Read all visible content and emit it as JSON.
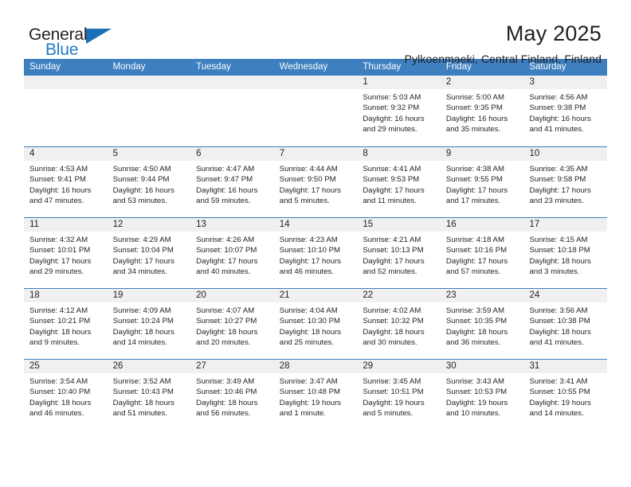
{
  "brand": {
    "name_top": "General",
    "name_bottom": "Blue",
    "accent_color": "#1b6fb5"
  },
  "header": {
    "month_title": "May 2025",
    "location": "Pylkoenmaeki, Central Finland, Finland"
  },
  "calendar": {
    "header_color": "#3d7fbf",
    "band_color": "#f0f0f0",
    "weekdays": [
      "Sunday",
      "Monday",
      "Tuesday",
      "Wednesday",
      "Thursday",
      "Friday",
      "Saturday"
    ],
    "weeks": [
      [
        {
          "day": "",
          "lines": []
        },
        {
          "day": "",
          "lines": []
        },
        {
          "day": "",
          "lines": []
        },
        {
          "day": "",
          "lines": []
        },
        {
          "day": "1",
          "lines": [
            "Sunrise: 5:03 AM",
            "Sunset: 9:32 PM",
            "Daylight: 16 hours",
            "and 29 minutes."
          ]
        },
        {
          "day": "2",
          "lines": [
            "Sunrise: 5:00 AM",
            "Sunset: 9:35 PM",
            "Daylight: 16 hours",
            "and 35 minutes."
          ]
        },
        {
          "day": "3",
          "lines": [
            "Sunrise: 4:56 AM",
            "Sunset: 9:38 PM",
            "Daylight: 16 hours",
            "and 41 minutes."
          ]
        }
      ],
      [
        {
          "day": "4",
          "lines": [
            "Sunrise: 4:53 AM",
            "Sunset: 9:41 PM",
            "Daylight: 16 hours",
            "and 47 minutes."
          ]
        },
        {
          "day": "5",
          "lines": [
            "Sunrise: 4:50 AM",
            "Sunset: 9:44 PM",
            "Daylight: 16 hours",
            "and 53 minutes."
          ]
        },
        {
          "day": "6",
          "lines": [
            "Sunrise: 4:47 AM",
            "Sunset: 9:47 PM",
            "Daylight: 16 hours",
            "and 59 minutes."
          ]
        },
        {
          "day": "7",
          "lines": [
            "Sunrise: 4:44 AM",
            "Sunset: 9:50 PM",
            "Daylight: 17 hours",
            "and 5 minutes."
          ]
        },
        {
          "day": "8",
          "lines": [
            "Sunrise: 4:41 AM",
            "Sunset: 9:53 PM",
            "Daylight: 17 hours",
            "and 11 minutes."
          ]
        },
        {
          "day": "9",
          "lines": [
            "Sunrise: 4:38 AM",
            "Sunset: 9:55 PM",
            "Daylight: 17 hours",
            "and 17 minutes."
          ]
        },
        {
          "day": "10",
          "lines": [
            "Sunrise: 4:35 AM",
            "Sunset: 9:58 PM",
            "Daylight: 17 hours",
            "and 23 minutes."
          ]
        }
      ],
      [
        {
          "day": "11",
          "lines": [
            "Sunrise: 4:32 AM",
            "Sunset: 10:01 PM",
            "Daylight: 17 hours",
            "and 29 minutes."
          ]
        },
        {
          "day": "12",
          "lines": [
            "Sunrise: 4:29 AM",
            "Sunset: 10:04 PM",
            "Daylight: 17 hours",
            "and 34 minutes."
          ]
        },
        {
          "day": "13",
          "lines": [
            "Sunrise: 4:26 AM",
            "Sunset: 10:07 PM",
            "Daylight: 17 hours",
            "and 40 minutes."
          ]
        },
        {
          "day": "14",
          "lines": [
            "Sunrise: 4:23 AM",
            "Sunset: 10:10 PM",
            "Daylight: 17 hours",
            "and 46 minutes."
          ]
        },
        {
          "day": "15",
          "lines": [
            "Sunrise: 4:21 AM",
            "Sunset: 10:13 PM",
            "Daylight: 17 hours",
            "and 52 minutes."
          ]
        },
        {
          "day": "16",
          "lines": [
            "Sunrise: 4:18 AM",
            "Sunset: 10:16 PM",
            "Daylight: 17 hours",
            "and 57 minutes."
          ]
        },
        {
          "day": "17",
          "lines": [
            "Sunrise: 4:15 AM",
            "Sunset: 10:18 PM",
            "Daylight: 18 hours",
            "and 3 minutes."
          ]
        }
      ],
      [
        {
          "day": "18",
          "lines": [
            "Sunrise: 4:12 AM",
            "Sunset: 10:21 PM",
            "Daylight: 18 hours",
            "and 9 minutes."
          ]
        },
        {
          "day": "19",
          "lines": [
            "Sunrise: 4:09 AM",
            "Sunset: 10:24 PM",
            "Daylight: 18 hours",
            "and 14 minutes."
          ]
        },
        {
          "day": "20",
          "lines": [
            "Sunrise: 4:07 AM",
            "Sunset: 10:27 PM",
            "Daylight: 18 hours",
            "and 20 minutes."
          ]
        },
        {
          "day": "21",
          "lines": [
            "Sunrise: 4:04 AM",
            "Sunset: 10:30 PM",
            "Daylight: 18 hours",
            "and 25 minutes."
          ]
        },
        {
          "day": "22",
          "lines": [
            "Sunrise: 4:02 AM",
            "Sunset: 10:32 PM",
            "Daylight: 18 hours",
            "and 30 minutes."
          ]
        },
        {
          "day": "23",
          "lines": [
            "Sunrise: 3:59 AM",
            "Sunset: 10:35 PM",
            "Daylight: 18 hours",
            "and 36 minutes."
          ]
        },
        {
          "day": "24",
          "lines": [
            "Sunrise: 3:56 AM",
            "Sunset: 10:38 PM",
            "Daylight: 18 hours",
            "and 41 minutes."
          ]
        }
      ],
      [
        {
          "day": "25",
          "lines": [
            "Sunrise: 3:54 AM",
            "Sunset: 10:40 PM",
            "Daylight: 18 hours",
            "and 46 minutes."
          ]
        },
        {
          "day": "26",
          "lines": [
            "Sunrise: 3:52 AM",
            "Sunset: 10:43 PM",
            "Daylight: 18 hours",
            "and 51 minutes."
          ]
        },
        {
          "day": "27",
          "lines": [
            "Sunrise: 3:49 AM",
            "Sunset: 10:46 PM",
            "Daylight: 18 hours",
            "and 56 minutes."
          ]
        },
        {
          "day": "28",
          "lines": [
            "Sunrise: 3:47 AM",
            "Sunset: 10:48 PM",
            "Daylight: 19 hours",
            "and 1 minute."
          ]
        },
        {
          "day": "29",
          "lines": [
            "Sunrise: 3:45 AM",
            "Sunset: 10:51 PM",
            "Daylight: 19 hours",
            "and 5 minutes."
          ]
        },
        {
          "day": "30",
          "lines": [
            "Sunrise: 3:43 AM",
            "Sunset: 10:53 PM",
            "Daylight: 19 hours",
            "and 10 minutes."
          ]
        },
        {
          "day": "31",
          "lines": [
            "Sunrise: 3:41 AM",
            "Sunset: 10:55 PM",
            "Daylight: 19 hours",
            "and 14 minutes."
          ]
        }
      ]
    ]
  }
}
